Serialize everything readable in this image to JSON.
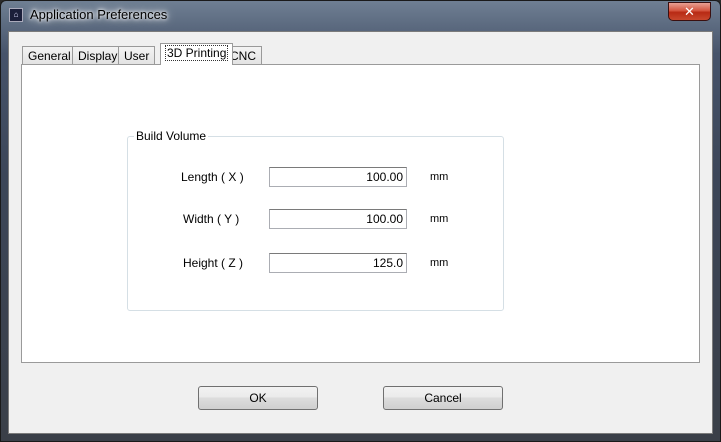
{
  "window": {
    "title": "Application Preferences",
    "close_glyph": "✕",
    "app_icon_glyph": "⌂"
  },
  "tabs": [
    {
      "label": "General",
      "active": false
    },
    {
      "label": "Display",
      "active": false
    },
    {
      "label": "User",
      "active": false
    },
    {
      "label": "3D Printing",
      "active": true
    },
    {
      "label": "CNC",
      "active": false
    }
  ],
  "build_volume": {
    "legend": "Build Volume",
    "length": {
      "label": "Length ( X )",
      "value": "100.00",
      "unit": "mm"
    },
    "width": {
      "label": "Width ( Y )",
      "value": "100.00",
      "unit": "mm"
    },
    "height": {
      "label": "Height ( Z )",
      "value": "125.0",
      "unit": "mm"
    }
  },
  "buttons": {
    "ok": "OK",
    "cancel": "Cancel"
  },
  "colors": {
    "close_button": "#c8472d",
    "panel_background": "#ffffff",
    "dialog_background": "#f0f0f0"
  }
}
